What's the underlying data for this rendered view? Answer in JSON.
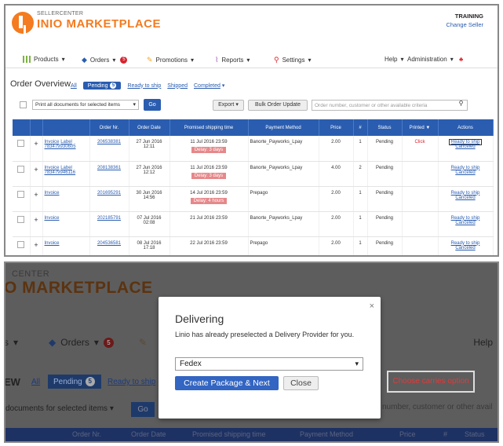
{
  "header": {
    "logo_top": "SELLER",
    "logo_top_light": "CENTER",
    "logo_main": "INIO MARKETPLACE",
    "account_name": "TRAINING",
    "change_seller": "Change Seller"
  },
  "nav": {
    "products": "Products",
    "orders": "Orders",
    "orders_badge": "5",
    "promotions": "Promotions",
    "reports": "Reports",
    "settings": "Settings",
    "help": "Help",
    "administration": "Administration"
  },
  "overview": {
    "title": "Order Overview",
    "all": "All",
    "pending": "Pending",
    "pending_count": "5",
    "ready_to_ship": "Ready to ship",
    "shipped": "Shipped",
    "completed": "Completed"
  },
  "toolbar": {
    "print_select": "Print all documents for selected items",
    "go": "Go",
    "export": "Export",
    "bulk": "Bulk Order Update",
    "search_placeholder": "Order number, customer or other available criteria"
  },
  "table": {
    "headers": [
      "Order Nr.",
      "Order Date",
      "Promised shipping time",
      "Payment Method",
      "Price",
      "#",
      "Status",
      "Printed",
      "Actions"
    ],
    "rows": [
      {
        "doc1": "Invoice",
        "doc2": "Label",
        "doc3": "783479930605",
        "order": "206538381",
        "date": "27 Jun 2016",
        "time": "12:11",
        "promised": "11 Jul 2016 23:59",
        "delay": "Delay: 3 days",
        "payment": "Banorte_Payworks_Lpay",
        "price": "2.00",
        "qty": "1",
        "status": "Pending",
        "printed": "Click",
        "a1": "Ready to ship",
        "a2": "Canceled"
      },
      {
        "doc1": "Invoice",
        "doc2": "Label",
        "doc3": "783479946116",
        "order": "208138361",
        "date": "27 Jun 2016",
        "time": "12:12",
        "promised": "11 Jul 2016 23:59",
        "delay": "Delay: 3 days",
        "payment": "Banorte_Payworks_Lpay",
        "price": "4.00",
        "qty": "2",
        "status": "Pending",
        "printed": "",
        "a1": "Ready to ship",
        "a2": "Canceled"
      },
      {
        "doc1": "Invoice",
        "doc2": "",
        "doc3": "",
        "order": "201695291",
        "date": "30 Jun 2016",
        "time": "14:56",
        "promised": "14 Jul 2016 23:59",
        "delay": "Delay: 4 hours",
        "payment": "Prepago",
        "price": "2.00",
        "qty": "1",
        "status": "Pending",
        "printed": "",
        "a1": "Ready to ship",
        "a2": "Canceled"
      },
      {
        "doc1": "Invoice",
        "doc2": "",
        "doc3": "",
        "order": "202185791",
        "date": "07 Jul 2016",
        "time": "02:08",
        "promised": "21 Jul 2016 23:59",
        "delay": "",
        "payment": "Banorte_Payworks_Lpay",
        "price": "2.00",
        "qty": "1",
        "status": "Pending",
        "printed": "",
        "a1": "Ready to ship",
        "a2": "Canceled"
      },
      {
        "doc1": "Invoice",
        "doc2": "",
        "doc3": "",
        "order": "204536581",
        "date": "08 Jul 2016",
        "time": "17:18",
        "promised": "22 Jul 2016 23:59",
        "delay": "",
        "payment": "Prepago",
        "price": "2.00",
        "qty": "1",
        "status": "Pending",
        "printed": "",
        "a1": "Ready to ship",
        "a2": "Canceled"
      }
    ]
  },
  "bottom": {
    "logo_top": "CENTER",
    "logo_main": "O MARKETPLACE",
    "nav_left": "s",
    "orders": "Orders",
    "orders_badge": "5",
    "help": "Help",
    "ew": "EW",
    "all": "All",
    "pending": "Pending",
    "pending_count": "5",
    "ready_to_ship": "Ready to ship",
    "print_select": "documents for selected items",
    "go": "Go",
    "search": "number, customer or other avail",
    "th_order": "Order Nr.",
    "th_date": "Order Date",
    "th_promised": "Promised shipping time",
    "th_payment": "Payment Method",
    "th_price": "Price",
    "th_hash": "#",
    "th_status": "Status",
    "callout": "Choose carries option"
  },
  "modal": {
    "title": "Delivering",
    "text": "Linio has already preselected a Delivery Provider for you.",
    "provider": "Fedex",
    "primary": "Create Package & Next",
    "secondary": "Close",
    "close": "×"
  },
  "colors": {
    "brand_orange": "#f47b20",
    "primary_blue": "#2a5db0",
    "alert_red": "#d9232d"
  }
}
